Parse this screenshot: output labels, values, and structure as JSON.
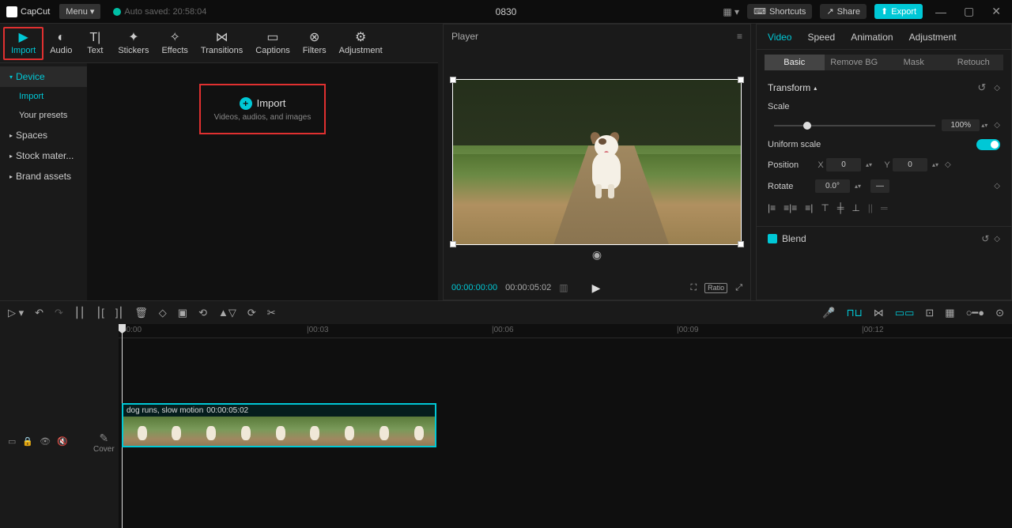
{
  "topbar": {
    "app_name": "CapCut",
    "menu_label": "Menu ▾",
    "autosave": "Auto saved: 20:58:04",
    "project_name": "0830",
    "shortcuts": "Shortcuts",
    "share": "Share",
    "export": "Export"
  },
  "tabs": {
    "import": "Import",
    "audio": "Audio",
    "text": "Text",
    "stickers": "Stickers",
    "effects": "Effects",
    "transitions": "Transitions",
    "captions": "Captions",
    "filters": "Filters",
    "adjustment": "Adjustment"
  },
  "sidebar": {
    "device": "Device",
    "import": "Import",
    "presets": "Your presets",
    "spaces": "Spaces",
    "stock": "Stock mater...",
    "brand": "Brand assets"
  },
  "import_box": {
    "label": "Import",
    "sub": "Videos, audios, and images"
  },
  "player": {
    "title": "Player",
    "current_time": "00:00:00:00",
    "duration": "00:00:05:02",
    "ratio": "Ratio"
  },
  "props": {
    "tab_video": "Video",
    "tab_speed": "Speed",
    "tab_animation": "Animation",
    "tab_adjustment": "Adjustment",
    "sub_basic": "Basic",
    "sub_removebg": "Remove BG",
    "sub_mask": "Mask",
    "sub_retouch": "Retouch",
    "transform": "Transform",
    "scale": "Scale",
    "scale_value": "100%",
    "uniform": "Uniform scale",
    "position": "Position",
    "pos_x_label": "X",
    "pos_x": "0",
    "pos_y_label": "Y",
    "pos_y": "0",
    "rotate": "Rotate",
    "rotate_value": "0.0°",
    "blend": "Blend"
  },
  "ruler": {
    "m0": "00:00",
    "m1": "|00:03",
    "m2": "|00:06",
    "m3": "|00:09",
    "m4": "|00:12"
  },
  "clip": {
    "name": "dog runs, slow motion",
    "duration": "00:00:05:02"
  },
  "cover": {
    "label": "Cover"
  }
}
